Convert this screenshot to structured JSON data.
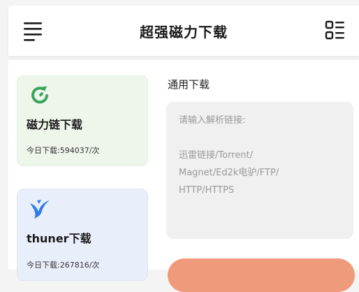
{
  "header": {
    "title": "超强磁力下载",
    "menu_icon": "hamburger-menu-icon",
    "grid_icon": "list-grid-icon"
  },
  "cards": [
    {
      "icon": "magnet-icon",
      "title": "磁力链下载",
      "count_label": "今日下载:594037/次",
      "accent": "#3aa55a",
      "background": "#eef6ec"
    },
    {
      "icon": "bird-icon",
      "title": "thuner下载",
      "count_label": "今日下载:267816/次",
      "accent": "#2f7de8",
      "background": "#e9eefb"
    }
  ],
  "main": {
    "section_title": "通用下载",
    "input_placeholder": "请输入解析链接:\n\n迅雷链接/Torrent/\nMagnet/Ed2k电驴/FTP/\nHTTP/HTTPS",
    "button_color": "#ef9a7b"
  }
}
